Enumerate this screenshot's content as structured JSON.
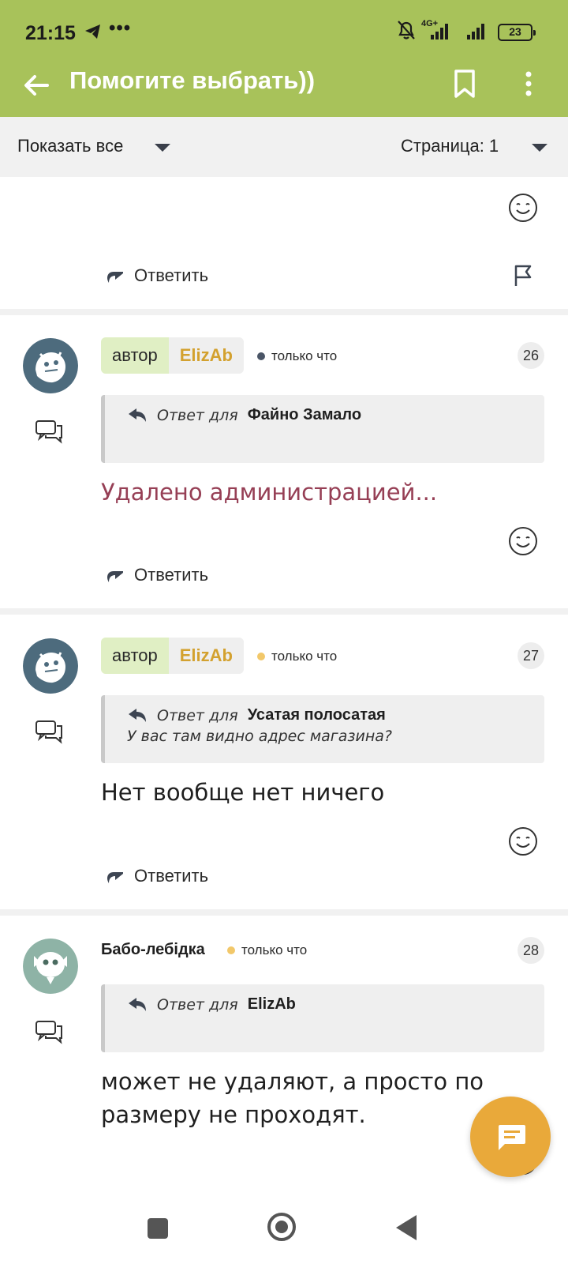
{
  "status_bar": {
    "time": "21:15",
    "network": "4G+",
    "battery": "23"
  },
  "app_bar": {
    "title": "Помогите выбрать))"
  },
  "filter_bar": {
    "show_label": "Показать все",
    "page_label": "Страница: 1"
  },
  "actions": {
    "reply_label": "Ответить"
  },
  "posts": [
    {
      "role": "автор",
      "nick": "ElizAb",
      "status_color": "#4a5566",
      "time": "только что",
      "number": "26",
      "reply_prefix": "Ответ для",
      "reply_to": "Файно Замало",
      "quote_text": "",
      "body": "Удалено администрацией..."
    },
    {
      "role": "автор",
      "nick": "ElizAb",
      "status_color": "#f2c86a",
      "time": "только что",
      "number": "27",
      "reply_prefix": "Ответ для",
      "reply_to": "Усатая полосатая",
      "quote_text": "У вас там видно адрес магазина?",
      "body": "Нет вообще нет ничего"
    },
    {
      "nick": "Бабо-лебідка",
      "status_color": "#f2c86a",
      "time": "только что",
      "number": "28",
      "reply_prefix": "Ответ для",
      "reply_to": "ElizAb",
      "quote_text": "",
      "body_line1": "может не удаляют, а просто по",
      "body_line2": "размеру не проходят."
    }
  ],
  "colors": {
    "app_bar": "#a8c25a",
    "deleted_text": "#963f55",
    "nick": "#d3a12f",
    "fab": "#e9a93a"
  }
}
